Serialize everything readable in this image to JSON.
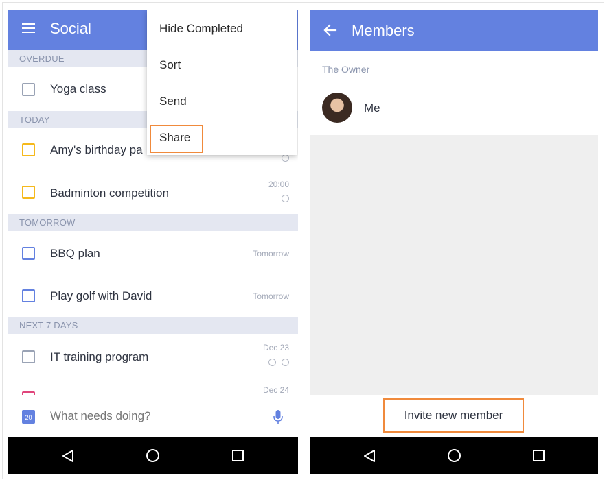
{
  "left_screen": {
    "appbar": {
      "title": "Social",
      "menu_icon": "hamburger-icon"
    },
    "sections": [
      {
        "label": "OVERDUE",
        "tasks": [
          {
            "title": "Yoga class",
            "date": "",
            "checkbox_color": "#9aa3b5"
          }
        ]
      },
      {
        "label": "TODAY",
        "tasks": [
          {
            "title": "Amy's birthday pa",
            "date": "",
            "checkbox_color": "#f5b91c"
          },
          {
            "title": "Badminton competition",
            "date": "20:00",
            "checkbox_color": "#f5b91c"
          }
        ]
      },
      {
        "label": "TOMORROW",
        "tasks": [
          {
            "title": "BBQ plan",
            "date": "Tomorrow",
            "checkbox_color": "#6381e0"
          },
          {
            "title": "Play golf with David",
            "date": "Tomorrow",
            "checkbox_color": "#6381e0"
          }
        ]
      },
      {
        "label": "NEXT 7 DAYS",
        "tasks": [
          {
            "title": "IT training program",
            "date": "Dec 23",
            "checkbox_color": "#9aa3b5"
          },
          {
            "title": "",
            "date": "Dec 24",
            "checkbox_color": "#e0457b"
          }
        ]
      }
    ],
    "composer": {
      "calendar_day": "20",
      "placeholder": "What needs doing?"
    },
    "overflow_menu": {
      "items": [
        "Hide Completed",
        "Sort",
        "Send",
        "Share"
      ],
      "highlighted": "Share"
    }
  },
  "right_screen": {
    "appbar": {
      "title": "Members"
    },
    "owner_section_label": "The Owner",
    "members": [
      {
        "name": "Me"
      }
    ],
    "invite_button_label": "Invite new member"
  },
  "colors": {
    "accent": "#6381e0",
    "highlight": "#f08a3c",
    "navbar": "#000000"
  }
}
